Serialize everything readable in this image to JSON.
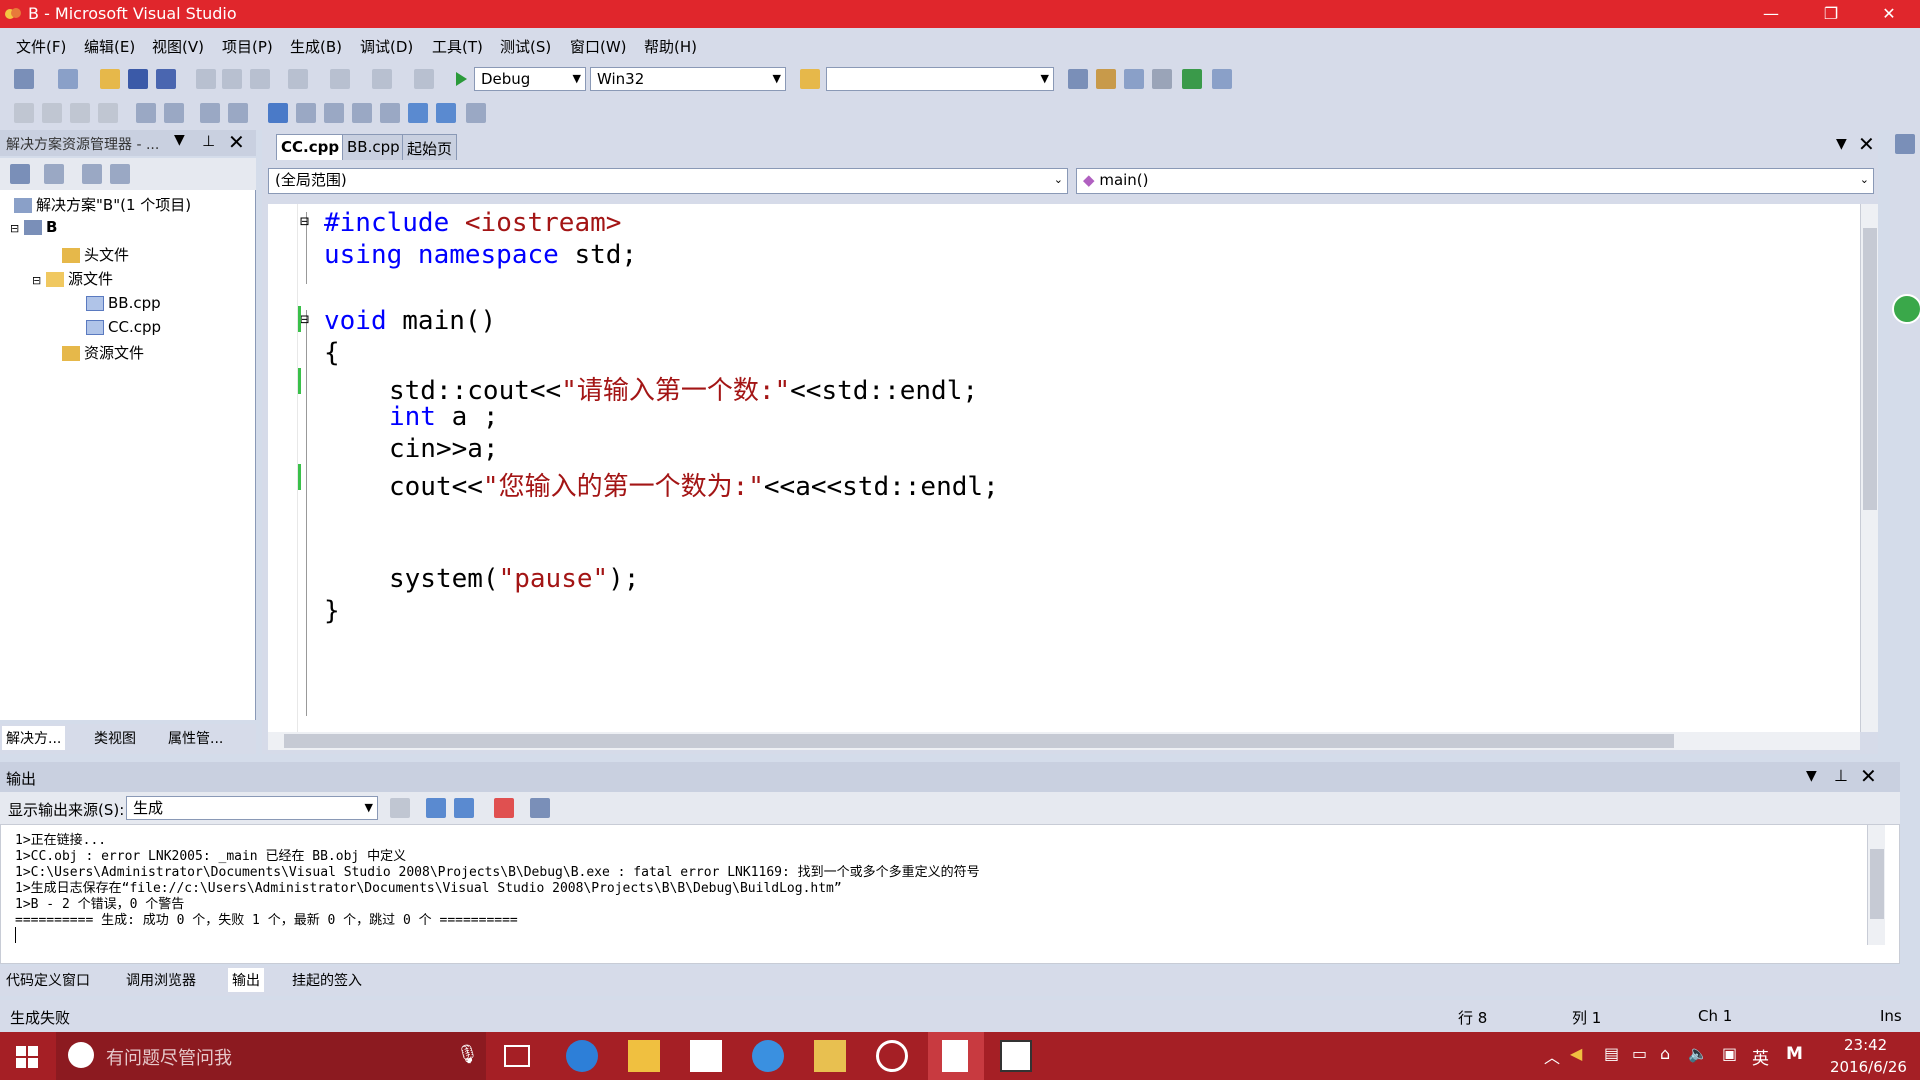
{
  "window": {
    "title": "B - Microsoft Visual Studio",
    "controls": {
      "minimize": "—",
      "restore": "❐",
      "close": "✕"
    }
  },
  "menu": [
    "文件(F)",
    "编辑(E)",
    "视图(V)",
    "项目(P)",
    "生成(B)",
    "调试(D)",
    "工具(T)",
    "测试(S)",
    "窗口(W)",
    "帮助(H)"
  ],
  "toolbar": {
    "config": "Debug",
    "platform": "Win32",
    "find_value": ""
  },
  "explorer": {
    "title": "解决方案资源管理器 - ...",
    "solution": "解决方案\"B\"(1 个项目)",
    "project": "B",
    "items": [
      "头文件",
      "源文件",
      "BB.cpp",
      "CC.cpp",
      "资源文件"
    ],
    "tabs": [
      "解决方...",
      "类视图",
      "属性管..."
    ]
  },
  "editor": {
    "tabs": [
      "CC.cpp",
      "BB.cpp",
      "起始页"
    ],
    "scope": "(全局范围)",
    "member": "main()",
    "code": {
      "l1_a": "#include ",
      "l1_b": "<iostream>",
      "l2_a": "using namespace ",
      "l2_b": "std;",
      "l3_a": "void ",
      "l3_b": "main()",
      "l4": "{",
      "l5_a": "std::cout<<",
      "l5_b": "\"请输入第一个数:\"",
      "l5_c": "<<std::endl;",
      "l6_a": "int ",
      "l6_b": "a ;",
      "l7": "cin>>a;",
      "l8_a": "cout<<",
      "l8_b": "\"您输入的第一个数为:\"",
      "l8_c": "<<a<<std::endl;",
      "l9_a": "system(",
      "l9_b": "\"pause\"",
      "l9_c": ");",
      "l10": "}"
    }
  },
  "output": {
    "title": "输出",
    "source_label": "显示输出来源(S):",
    "source_value": "生成",
    "lines": [
      "1>正在链接...",
      "1>CC.obj : error LNK2005: _main 已经在 BB.obj 中定义",
      "1>C:\\Users\\Administrator\\Documents\\Visual Studio 2008\\Projects\\B\\Debug\\B.exe : fatal error LNK1169: 找到一个或多个多重定义的符号",
      "1>生成日志保存在“file://c:\\Users\\Administrator\\Documents\\Visual Studio 2008\\Projects\\B\\B\\Debug\\BuildLog.htm”",
      "1>B - 2 个错误，0 个警告",
      "========== 生成: 成功 0 个，失败 1 个，最新 0 个，跳过 0 个 =========="
    ],
    "tabs": [
      "代码定义窗口",
      "调用浏览器",
      "输出",
      "挂起的签入"
    ]
  },
  "status": {
    "message": "生成失败",
    "row": "行 8",
    "col": "列 1",
    "ch": "Ch 1",
    "mode": "Ins"
  },
  "taskbar": {
    "search": "有问题尽管问我",
    "time": "23:42",
    "date": "2016/6/26",
    "ime": "英",
    "ime2": "M"
  },
  "colors": {
    "titlebar": "#e0262c",
    "taskbar": "#a51f25",
    "keyword": "#0000ff",
    "string": "#a31515"
  }
}
